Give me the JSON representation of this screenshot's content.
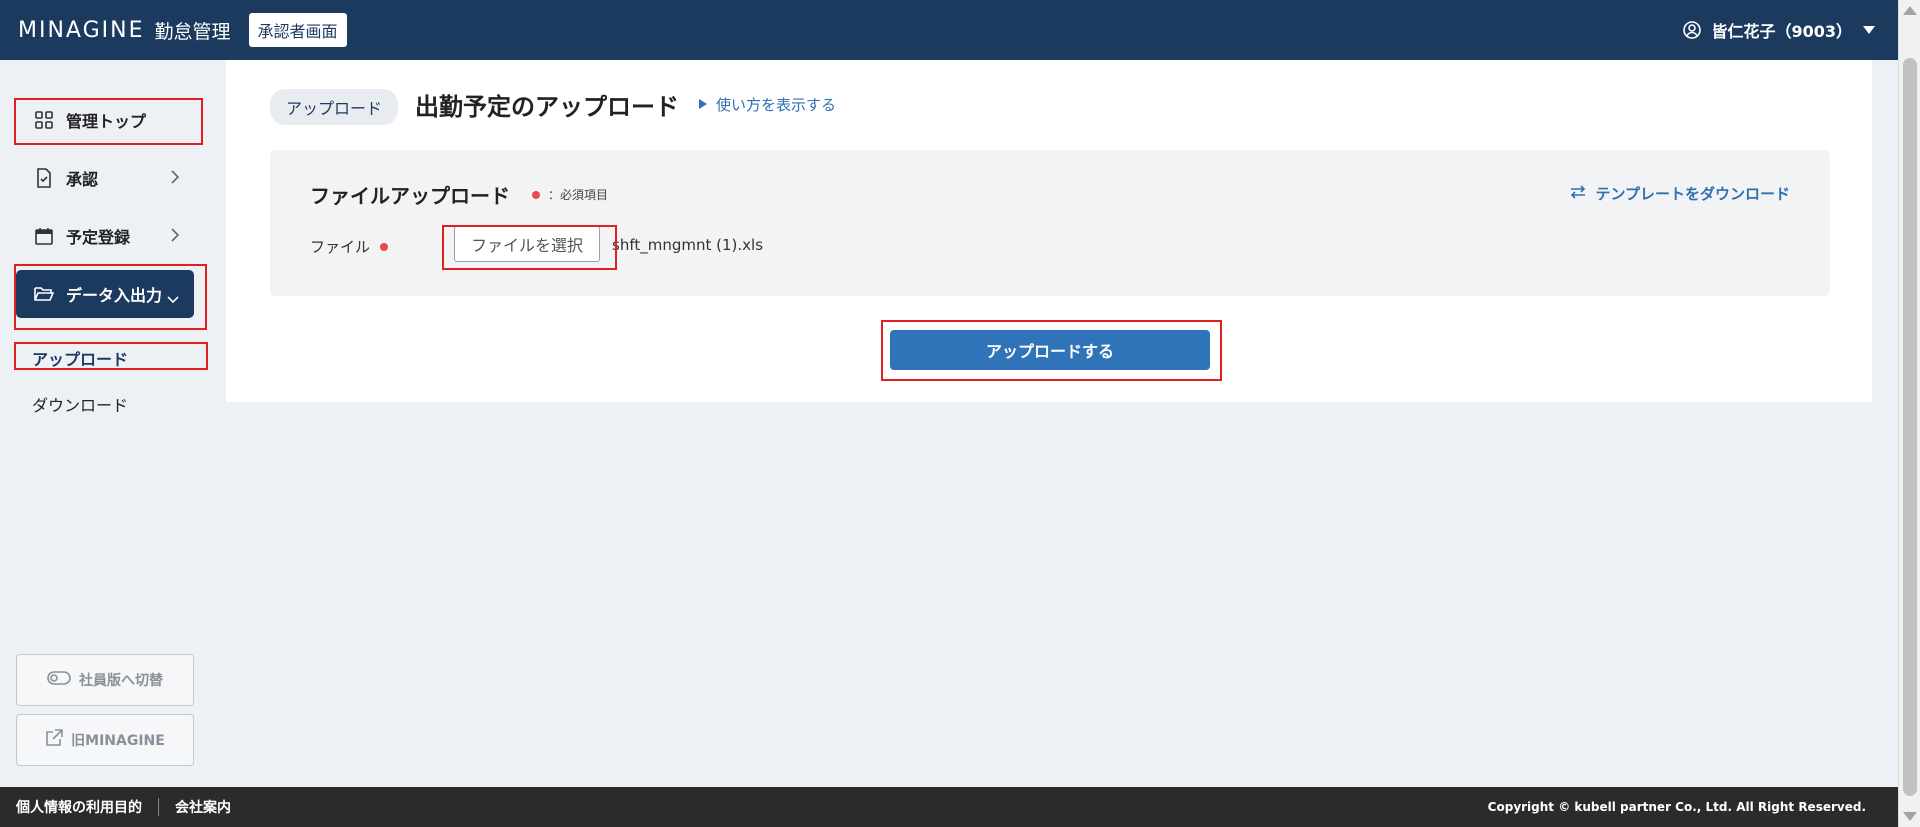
{
  "header": {
    "brand": "MINAGINE",
    "subtitle": "勤怠管理",
    "mode_badge": "承認者画面",
    "user_name": "皆仁花子（9003）"
  },
  "sidebar": {
    "items": [
      {
        "label": "管理トップ",
        "icon": "grid-icon"
      },
      {
        "label": "承認",
        "icon": "document-check-icon"
      },
      {
        "label": "予定登録",
        "icon": "calendar-icon"
      },
      {
        "label": "データ入出力",
        "icon": "folder-open-icon"
      }
    ],
    "sub_items": [
      {
        "label": "アップロード"
      },
      {
        "label": "ダウンロード"
      }
    ],
    "switch_label": "社員版へ切替",
    "legacy_label": "旧MINAGINE"
  },
  "main": {
    "crumb": "アップロード",
    "title": "出勤予定のアップロード",
    "howto": "使い方を表示する",
    "panel": {
      "title": "ファイルアップロード",
      "required_note": "：必須項目",
      "template_link": "テンプレートをダウンロード",
      "file_label": "ファイル",
      "file_button": "ファイルを選択",
      "file_name": "shft_mngmnt (1).xls"
    },
    "upload_button": "アップロードする"
  },
  "footer": {
    "privacy": "個人情報の利用目的",
    "company": "会社案内",
    "copyright": "Copyright © kubell partner Co., Ltd. All Right Reserved."
  },
  "colors": {
    "header_bg": "#1b3a5e",
    "primary": "#2f74b8",
    "link": "#2f6fb3",
    "required": "#e84a4a",
    "highlight": "#e02020"
  }
}
